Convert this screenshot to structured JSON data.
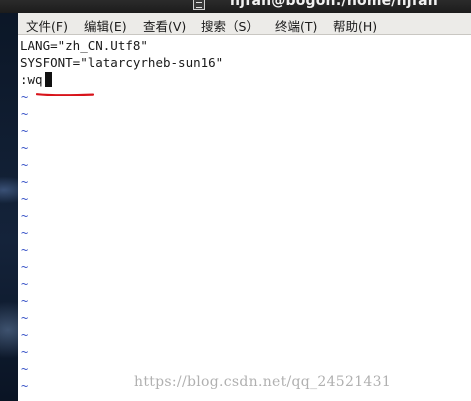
{
  "window": {
    "title": "njfan@bogon:/home/njfan"
  },
  "menu": {
    "items": [
      {
        "label": "文件(F)"
      },
      {
        "label": "编辑(E)"
      },
      {
        "label": "查看(V)"
      },
      {
        "label": "搜索（S）"
      },
      {
        "label": "终端(T)"
      },
      {
        "label": "帮助(H)"
      }
    ]
  },
  "terminal": {
    "lines": [
      "LANG=\"zh_CN.Utf8\"",
      "SYSFONT=\"latarcyrheb-sun16\"",
      ":wq"
    ],
    "empty_line_marker": "~",
    "empty_line_color": "#3b55c8",
    "annotation_color": "#d8141b"
  },
  "watermark": {
    "text": "https://blog.csdn.net/qq_24521431"
  }
}
